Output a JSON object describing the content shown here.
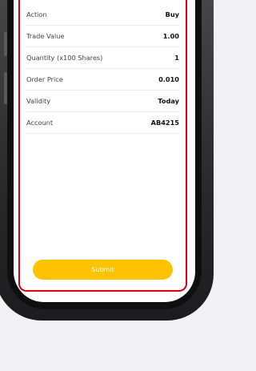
{
  "order": {
    "rows": [
      {
        "label": "Action",
        "value": "Buy"
      },
      {
        "label": "Trade Value",
        "value": "1.00"
      },
      {
        "label": "Quantity (x100 Shares)",
        "value": "1"
      },
      {
        "label": "Order Price",
        "value": "0.010"
      },
      {
        "label": "Validity",
        "value": "Today"
      },
      {
        "label": "Account",
        "value": "AB4215"
      }
    ],
    "submit_label": "Submit"
  },
  "colors": {
    "accent_red": "#d8000f",
    "submit_yellow": "#ffc200"
  }
}
